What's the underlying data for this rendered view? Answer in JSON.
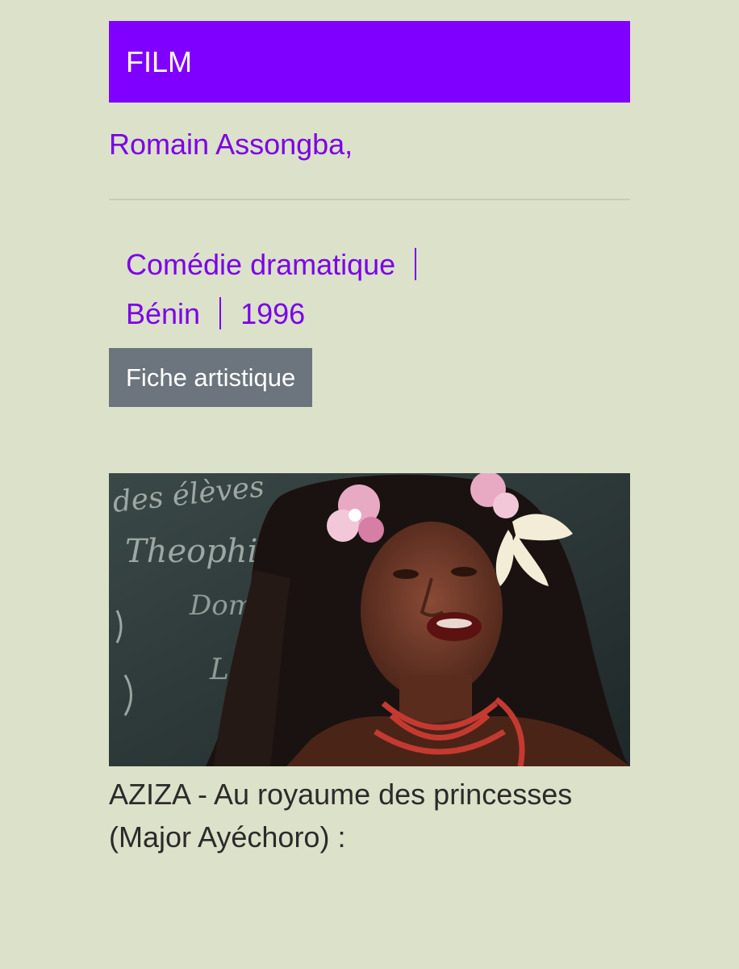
{
  "header": {
    "category": "FILM"
  },
  "film": {
    "director": "Romain Assongba,",
    "genre": "Comédie dramatique",
    "country": "Bénin",
    "year": "1996",
    "fiche_label": "Fiche artistique"
  },
  "media": {
    "caption": "AZIZA - Au royaume des princesses (Major Ayéchoro) :",
    "chalkboard_text": [
      "des élèves",
      "Theophi",
      "Dom",
      "L"
    ]
  }
}
